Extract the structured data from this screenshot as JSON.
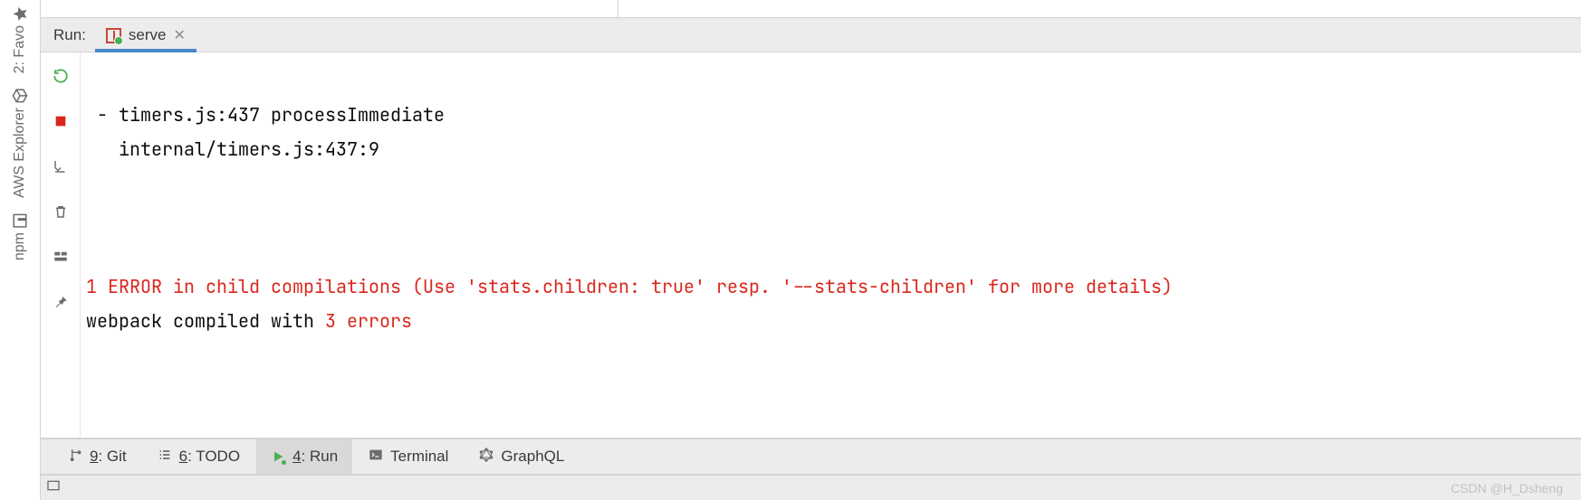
{
  "leftStrip": {
    "favorites": "2: Favo",
    "awsExplorer": "AWS Explorer",
    "npm": "npm"
  },
  "tabBar": {
    "runLabel": "Run:",
    "tabName": "serve"
  },
  "console": {
    "line1": " - timers.js:437 processImmediate",
    "line2": "   internal/timers.js:437:9",
    "errLine": "1 ERROR in child compilations (Use 'stats.children: true' resp. '--stats-children' for more details)",
    "compiled_pre": "webpack compiled with ",
    "compiled_err": "3 errors"
  },
  "bottomBar": {
    "git_num": "9",
    "git_label": ": Git",
    "todo_num": "6",
    "todo_label": ": TODO",
    "run_num": "4",
    "run_label": ": Run",
    "terminal": "Terminal",
    "graphql": "GraphQL"
  },
  "status": {
    "watermark": "CSDN @H_Dsheng"
  }
}
